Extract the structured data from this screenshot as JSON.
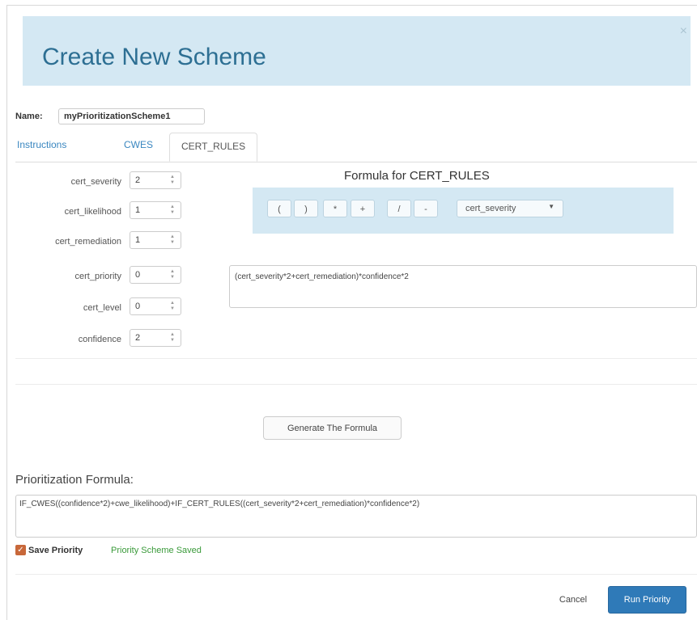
{
  "dialog": {
    "title": "Create New Scheme",
    "close_glyph": "×"
  },
  "name": {
    "label": "Name:",
    "value": "myPrioritizationScheme1"
  },
  "tabs": [
    {
      "label": "Instructions",
      "active": false
    },
    {
      "label": "CWES",
      "active": false
    },
    {
      "label": "CERT_RULES",
      "active": true
    }
  ],
  "params": [
    {
      "label": "cert_severity",
      "value": "2"
    },
    {
      "label": "cert_likelihood",
      "value": "1"
    },
    {
      "label": "cert_remediation",
      "value": "1"
    },
    {
      "label": "cert_priority",
      "value": "0"
    },
    {
      "label": "cert_level",
      "value": "0"
    },
    {
      "label": "confidence",
      "value": "2"
    }
  ],
  "formula_panel": {
    "title": "Formula for CERT_RULES",
    "operators": [
      "(",
      ")",
      "*",
      "+",
      "/",
      "-"
    ],
    "select_value": "cert_severity",
    "formula_text": "(cert_severity*2+cert_remediation)*confidence*2"
  },
  "generate_button": "Generate The Formula",
  "prioritization": {
    "label": "Prioritization Formula:",
    "formula": "IF_CWES((confidence*2)+cwe_likelihood)+IF_CERT_RULES((cert_severity*2+cert_remediation)*confidence*2)"
  },
  "save": {
    "checked": true,
    "label": "Save Priority",
    "status": "Priority Scheme Saved"
  },
  "footer": {
    "cancel_label": "Cancel",
    "run_label": "Run Priority"
  },
  "colors": {
    "header_bg": "#d4e8f3",
    "title_text": "#2d6f93",
    "link": "#3a87c0",
    "primary_button": "#2f7ab8",
    "checkbox": "#c8683a",
    "success_text": "#3a9a3a"
  }
}
